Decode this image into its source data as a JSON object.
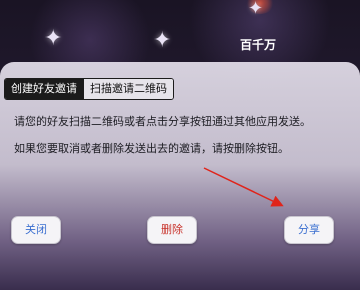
{
  "background": {
    "corner_text": "百千万"
  },
  "dialog": {
    "tabs": [
      {
        "label": "创建好友邀请",
        "active": true
      },
      {
        "label": "扫描邀请二维码",
        "active": false
      }
    ],
    "messages": [
      "请您的好友扫描二维码或者点击分享按钮通过其他应用发送。",
      "如果您要取消或者删除发送出去的邀请，请按删除按钮。"
    ],
    "buttons": {
      "close": "关闭",
      "delete": "删除",
      "share": "分享"
    }
  },
  "colors": {
    "link_blue": "#3b6fd0",
    "delete_red": "#c8322b",
    "annotation_arrow": "#e0241b"
  }
}
